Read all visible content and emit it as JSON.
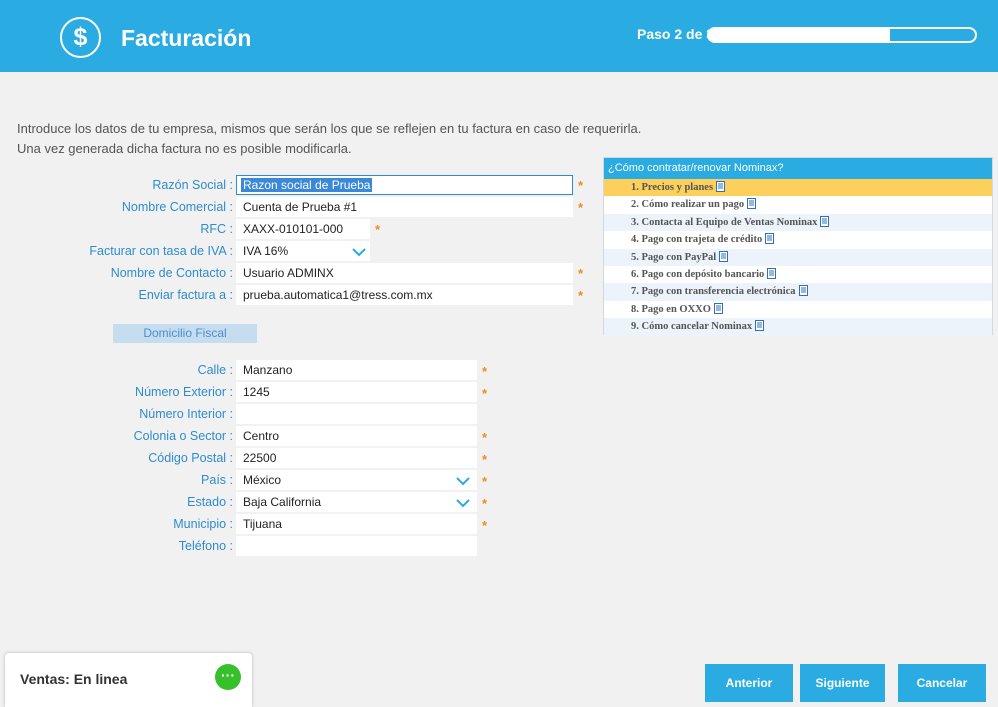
{
  "header": {
    "logo_glyph": "$",
    "title": "Facturación",
    "step_label": "Paso 2 de 3",
    "progress_fraction": 0.68
  },
  "intro": {
    "line1": "Introduce los datos de tu empresa, mismos que serán los que se reflejen en tu factura en caso de requerirla.",
    "line2": "Una vez generada dicha factura no es posible modificarla."
  },
  "company": {
    "razon_social": {
      "label": "Razón Social :",
      "value": "Razon social de Prueba"
    },
    "nombre_comercial": {
      "label": "Nombre Comercial :",
      "value": "Cuenta de Prueba #1"
    },
    "rfc": {
      "label": "RFC :",
      "value": "XAXX-010101-000"
    },
    "iva": {
      "label": "Facturar con tasa de IVA :",
      "value": "IVA 16%"
    },
    "contacto": {
      "label": "Nombre de Contacto :",
      "value": "Usuario ADMINX"
    },
    "enviar": {
      "label": "Enviar factura a :",
      "value": "prueba.automatica1@tress.com.mx"
    }
  },
  "address_section": "Domicilio Fiscal",
  "address": {
    "calle": {
      "label": "Calle :",
      "value": "Manzano"
    },
    "num_ext": {
      "label": "Número Exterior :",
      "value": "1245"
    },
    "num_int": {
      "label": "Número Interior :",
      "value": ""
    },
    "colonia": {
      "label": "Colonia o Sector :",
      "value": "Centro"
    },
    "cp": {
      "label": "Código Postal :",
      "value": "22500"
    },
    "pais": {
      "label": "País :",
      "value": "México"
    },
    "estado": {
      "label": "Estado :",
      "value": "Baja California"
    },
    "municipio": {
      "label": "Municipio :",
      "value": "Tijuana"
    },
    "telefono": {
      "label": "Teléfono :",
      "value": ""
    }
  },
  "required_mark": "*",
  "help": {
    "title": "¿Cómo contratar/renovar Nominax?",
    "items": [
      "1. Precios y planes",
      "2. Cómo realizar un pago",
      "3. Contacta al Equipo de Ventas Nominax",
      "4. Pago con trajeta de crédito",
      "5. Pago con PayPal",
      "6. Pago con depósito bancario",
      "7. Pago con transferencia electrónica",
      "8. Pago en OXXO",
      "9. Cómo cancelar Nominax"
    ]
  },
  "chat": {
    "label": "Ventas: En linea",
    "icon_glyph": "···"
  },
  "buttons": {
    "prev": "Anterior",
    "next": "Siguiente",
    "cancel": "Cancelar"
  },
  "colors": {
    "brand": "#2aace3",
    "label": "#2e8ccd",
    "required": "#f08a24",
    "active_help": "#fcd05b",
    "chat": "#35c02c"
  }
}
